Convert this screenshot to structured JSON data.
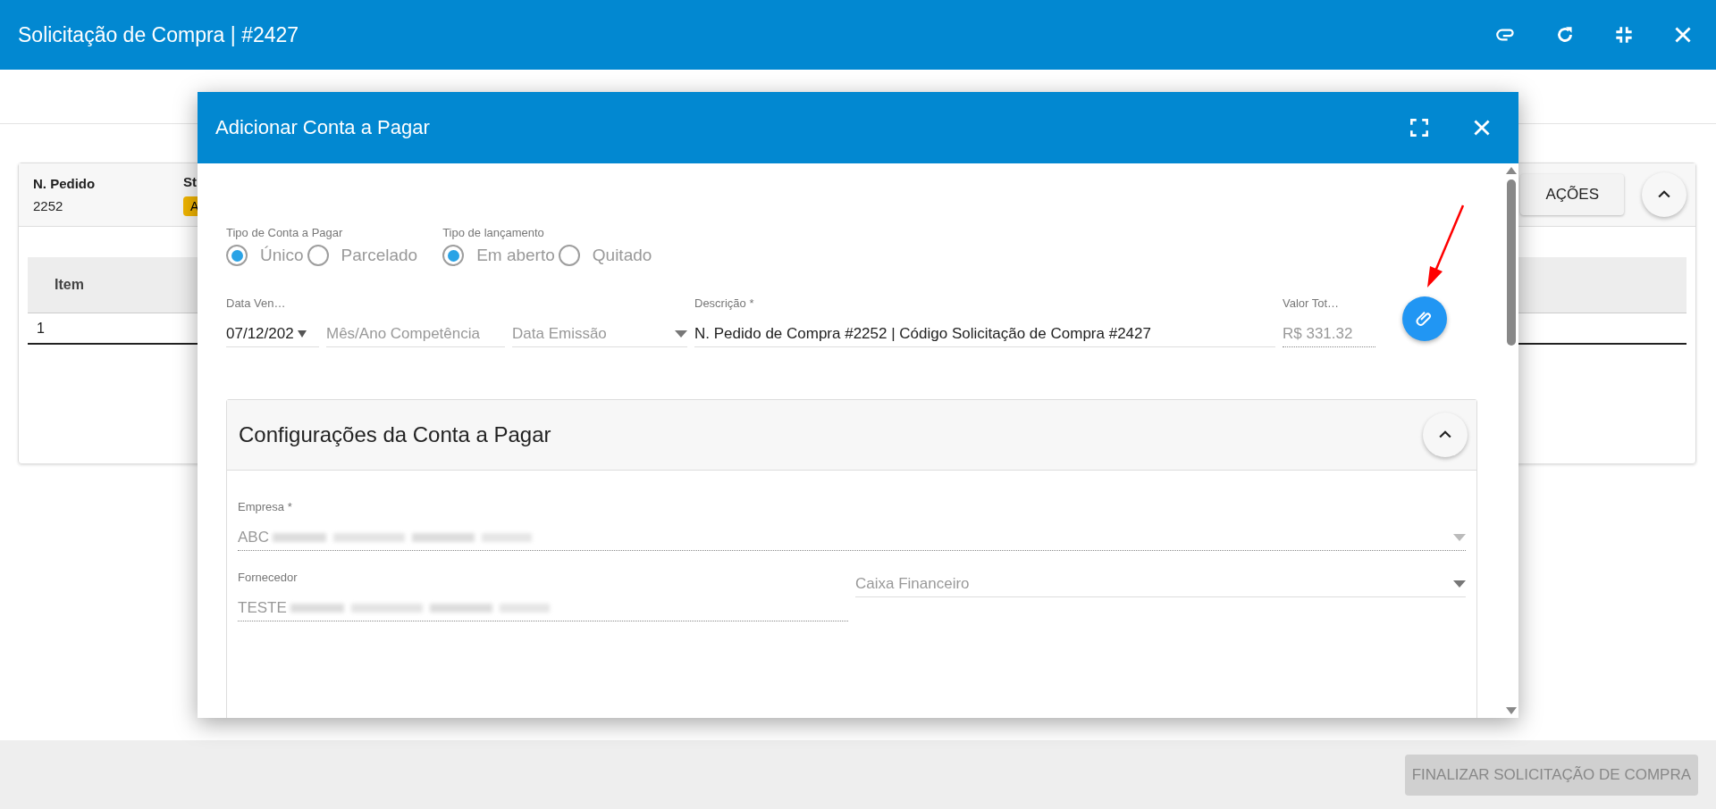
{
  "window": {
    "title": "Solicitação de Compra | #2427"
  },
  "order_card": {
    "columns": [
      {
        "label": "N. Pedido",
        "value": "2252"
      },
      {
        "label": "St",
        "badge": "A"
      }
    ],
    "actions_button": "AÇÕES",
    "expanded": true
  },
  "items_table": {
    "columns": [
      "Item"
    ],
    "rows": [
      [
        "1"
      ]
    ]
  },
  "footer": {
    "finalize_button": {
      "label": "FINALIZAR SOLICITAÇÃO DE COMPRA",
      "disabled": true
    }
  },
  "dialog": {
    "title": "Adicionar Conta a Pagar",
    "radio_groups": [
      {
        "label": "Tipo de Conta a Pagar",
        "options": [
          {
            "label": "Único",
            "selected": true
          },
          {
            "label": "Parcelado",
            "selected": false
          }
        ]
      },
      {
        "label": "Tipo de lançamento",
        "options": [
          {
            "label": "Em aberto",
            "selected": true
          },
          {
            "label": "Quitado",
            "selected": false
          }
        ]
      }
    ],
    "fields": [
      {
        "kind": "date",
        "label": "Data Ven…",
        "value": "07/12/202",
        "disabled": false
      },
      {
        "kind": "text",
        "placeholder": "Mês/Ano Competência",
        "disabled": false
      },
      {
        "kind": "select",
        "placeholder": "Data Emissão",
        "disabled": false
      },
      {
        "kind": "text",
        "label": "Descrição *",
        "value": "N. Pedido de Compra #2252 | Código Solicitação de Compra #2427",
        "disabled": false
      },
      {
        "kind": "text",
        "label": "Valor Tot…",
        "value": "R$ 331.32",
        "disabled": true
      }
    ],
    "config_panel": {
      "title": "Configurações da Conta a Pagar",
      "expanded": true,
      "rows": [
        [
          {
            "kind": "select",
            "label": "Empresa *",
            "value": "ABC",
            "disabled": true
          }
        ],
        [
          {
            "kind": "text",
            "label": "Fornecedor",
            "value": "TESTE",
            "disabled": true
          },
          {
            "kind": "select",
            "placeholder": "Caixa Financeiro",
            "disabled": false
          }
        ]
      ]
    }
  }
}
